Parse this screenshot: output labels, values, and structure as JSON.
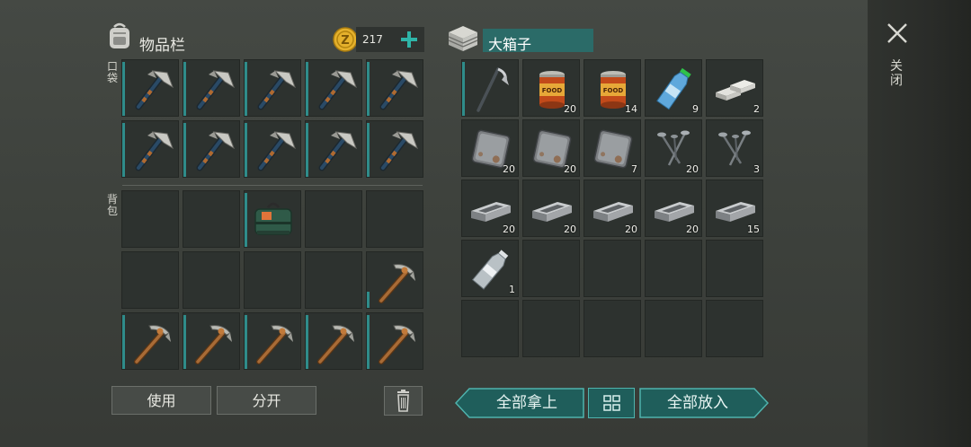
{
  "inventory": {
    "title": "物品栏",
    "coins": "217",
    "pocket_label": "口袋",
    "backpack_label": "背包"
  },
  "chest": {
    "name": "大箱子",
    "close_label": "关闭"
  },
  "buttons": {
    "use": "使用",
    "split": "分开",
    "take_all": "全部拿上",
    "put_all": "全部放入"
  },
  "pocket_slots": [
    {
      "item": "hatchet"
    },
    {
      "item": "hatchet"
    },
    {
      "item": "hatchet"
    },
    {
      "item": "hatchet"
    },
    {
      "item": "hatchet"
    },
    {
      "item": "hatchet"
    },
    {
      "item": "hatchet"
    },
    {
      "item": "hatchet"
    },
    {
      "item": "hatchet"
    },
    {
      "item": "hatchet"
    }
  ],
  "backpack_slots": [
    {
      "item": ""
    },
    {
      "item": ""
    },
    {
      "item": "green-bag"
    },
    {
      "item": ""
    },
    {
      "item": ""
    },
    {
      "item": ""
    },
    {
      "item": ""
    },
    {
      "item": ""
    },
    {
      "item": ""
    },
    {
      "item": "pickaxe",
      "partial": true
    },
    {
      "item": "pickaxe"
    },
    {
      "item": "pickaxe"
    },
    {
      "item": "pickaxe"
    },
    {
      "item": "pickaxe"
    },
    {
      "item": "pickaxe"
    }
  ],
  "chest_slots": [
    {
      "item": "hoe",
      "count": ""
    },
    {
      "item": "food-can",
      "count": "20"
    },
    {
      "item": "food-can",
      "count": "14"
    },
    {
      "item": "water-bottle",
      "count": "9"
    },
    {
      "item": "aluminum-bars",
      "count": "2"
    },
    {
      "item": "metal-plate",
      "count": "20"
    },
    {
      "item": "metal-plate",
      "count": "20"
    },
    {
      "item": "metal-plate",
      "count": "7"
    },
    {
      "item": "nails",
      "count": "20"
    },
    {
      "item": "nails",
      "count": "3"
    },
    {
      "item": "iron-bar",
      "count": "20"
    },
    {
      "item": "iron-bar",
      "count": "20"
    },
    {
      "item": "iron-bar",
      "count": "20"
    },
    {
      "item": "iron-bar",
      "count": "20"
    },
    {
      "item": "iron-bar",
      "count": "15"
    },
    {
      "item": "empty-bottle",
      "count": "1"
    },
    {
      "item": "",
      "count": ""
    },
    {
      "item": "",
      "count": ""
    },
    {
      "item": "",
      "count": ""
    },
    {
      "item": "",
      "count": ""
    },
    {
      "item": "",
      "count": ""
    },
    {
      "item": "",
      "count": ""
    },
    {
      "item": "",
      "count": ""
    },
    {
      "item": "",
      "count": ""
    },
    {
      "item": "",
      "count": ""
    }
  ],
  "colors": {
    "accent": "#2f8c8a",
    "teal_button": "#1f5e5b",
    "coin": "#e5b12c"
  }
}
